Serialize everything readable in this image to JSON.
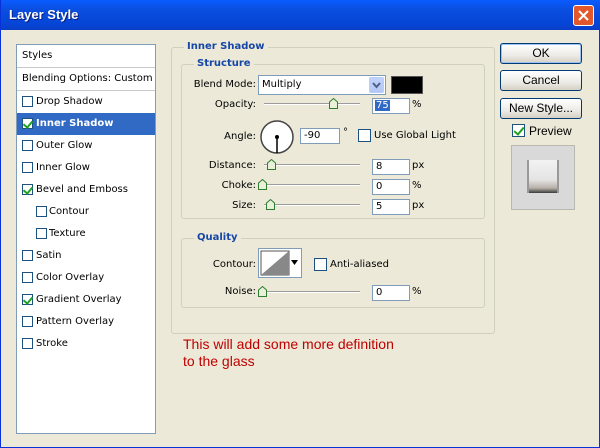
{
  "window": {
    "title": "Layer Style"
  },
  "styles_list": {
    "header": "Styles",
    "blending": "Blending Options: Custom",
    "items": [
      {
        "label": "Drop Shadow",
        "checked": false
      },
      {
        "label": "Inner Shadow",
        "checked": true,
        "selected": true
      },
      {
        "label": "Outer Glow",
        "checked": false
      },
      {
        "label": "Inner Glow",
        "checked": false
      },
      {
        "label": "Bevel and Emboss",
        "checked": true
      },
      {
        "label": "Contour",
        "checked": false,
        "sub": true
      },
      {
        "label": "Texture",
        "checked": false,
        "sub": true
      },
      {
        "label": "Satin",
        "checked": false
      },
      {
        "label": "Color Overlay",
        "checked": false
      },
      {
        "label": "Gradient Overlay",
        "checked": true
      },
      {
        "label": "Pattern Overlay",
        "checked": false
      },
      {
        "label": "Stroke",
        "checked": false
      }
    ]
  },
  "panel": {
    "title": "Inner Shadow",
    "structure": {
      "title": "Structure",
      "blend_mode_label": "Blend Mode:",
      "blend_mode": "Multiply",
      "shadow_color": "#000000",
      "opacity_label": "Opacity:",
      "opacity": "75",
      "opacity_level": 0.75,
      "opacity_unit": "%",
      "angle_label": "Angle:",
      "angle": "-90",
      "angle_unit": "°",
      "global_light_label": "Use Global Light",
      "global_light": false,
      "distance_label": "Distance:",
      "distance": "8",
      "distance_level": 0.03,
      "distance_unit": "px",
      "choke_label": "Choke:",
      "choke": "0",
      "choke_level": 0,
      "choke_unit": "%",
      "size_label": "Size:",
      "size": "5",
      "size_level": 0.02,
      "size_unit": "px"
    },
    "quality": {
      "title": "Quality",
      "contour_label": "Contour:",
      "anti_aliased_label": "Anti-aliased",
      "anti_aliased": false,
      "noise_label": "Noise:",
      "noise": "0",
      "noise_level": 0,
      "noise_unit": "%"
    }
  },
  "annotation": {
    "line1": "This will add some more definition",
    "line2": "to the glass"
  },
  "buttons": {
    "ok": "OK",
    "cancel": "Cancel",
    "new_style": "New Style..."
  },
  "preview": {
    "label": "Preview",
    "checked": true
  },
  "colors": {
    "title_bar": "#0a4fe0",
    "selection": "#316ac5",
    "annotation": "#c00000",
    "group_title": "#1546a8"
  }
}
